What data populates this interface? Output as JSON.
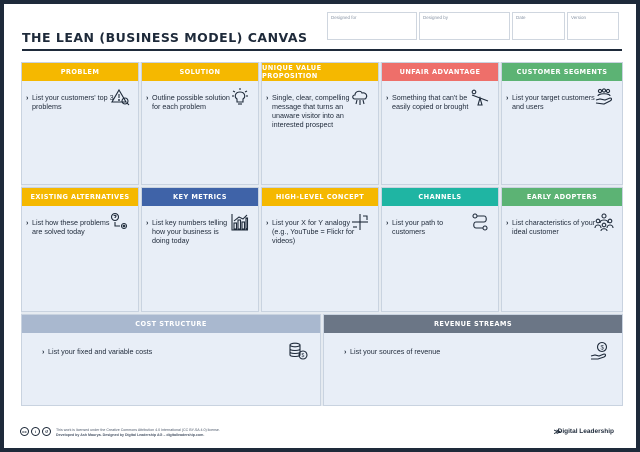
{
  "title": "THE LEAN (BUSINESS MODEL) CANVAS",
  "meta": {
    "designed_for": "Designed for",
    "designed_by": "Designed by",
    "date": "Date",
    "version": "Version"
  },
  "blocks": {
    "problem": {
      "title": "PROBLEM",
      "text": "List your customers' top 3 problems",
      "color": "#f5b800",
      "icon": "warning-magnifier-icon"
    },
    "solution": {
      "title": "SOLUTION",
      "text": "Outline possible solution for each problem",
      "color": "#f5b800",
      "icon": "lightbulb-icon"
    },
    "uvp": {
      "title": "UNIQUE VALUE PROPOSITION",
      "text": "Single, clear, compelling message that turns an unaware visitor into an interested prospect",
      "color": "#f5b800",
      "icon": "cloud-idea-icon"
    },
    "unfair": {
      "title": "UNFAIR ADVANTAGE",
      "text": "Something that can't be easily copied or brought",
      "color": "#ee6f6a",
      "icon": "seesaw-icon"
    },
    "segments": {
      "title": "CUSTOMER SEGMENTS",
      "text": "List your target customers and users",
      "color": "#5cb374",
      "icon": "people-hand-icon"
    },
    "alternatives": {
      "title": "EXISTING ALTERNATIVES",
      "text": "List how these problems are solved today",
      "color": "#f5b800",
      "icon": "question-process-icon"
    },
    "metrics": {
      "title": "KEY METRICS",
      "text": "List key numbers telling how your business is doing today",
      "color": "#3f63a8",
      "icon": "bar-chart-icon"
    },
    "concept": {
      "title": "HIGH-LEVEL CONCEPT",
      "text": "List your X for Y analogy (e.g., YouTube = Flickr for videos)",
      "color": "#f5b800",
      "icon": "crossroads-icon"
    },
    "channels": {
      "title": "CHANNELS",
      "text": "List your path to customers",
      "color": "#1fb5a3",
      "icon": "route-icon"
    },
    "adopters": {
      "title": "EARLY ADOPTERS",
      "text": "List characteristics of your ideal customer",
      "color": "#5cb374",
      "icon": "group-icon"
    },
    "cost": {
      "title": "COST STRUCTURE",
      "text": "List your fixed and variable costs",
      "color": "#a9b8cf",
      "icon": "coins-icon"
    },
    "revenue": {
      "title": "REVENUE STREAMS",
      "text": "List your sources of revenue",
      "color": "#6b7686",
      "icon": "money-hand-icon"
    }
  },
  "footer": {
    "license": "This work is licensed under the Creative Commons Attribution 4.0 International (CC BY-SA 4.0) license.",
    "credits": "Developed by Ash Maurya. Designed by Digital Leadership AG – digitalleadership.com.",
    "brand": "Digital Leadership",
    "cc_icons": [
      "cc",
      "by",
      "sa"
    ]
  }
}
